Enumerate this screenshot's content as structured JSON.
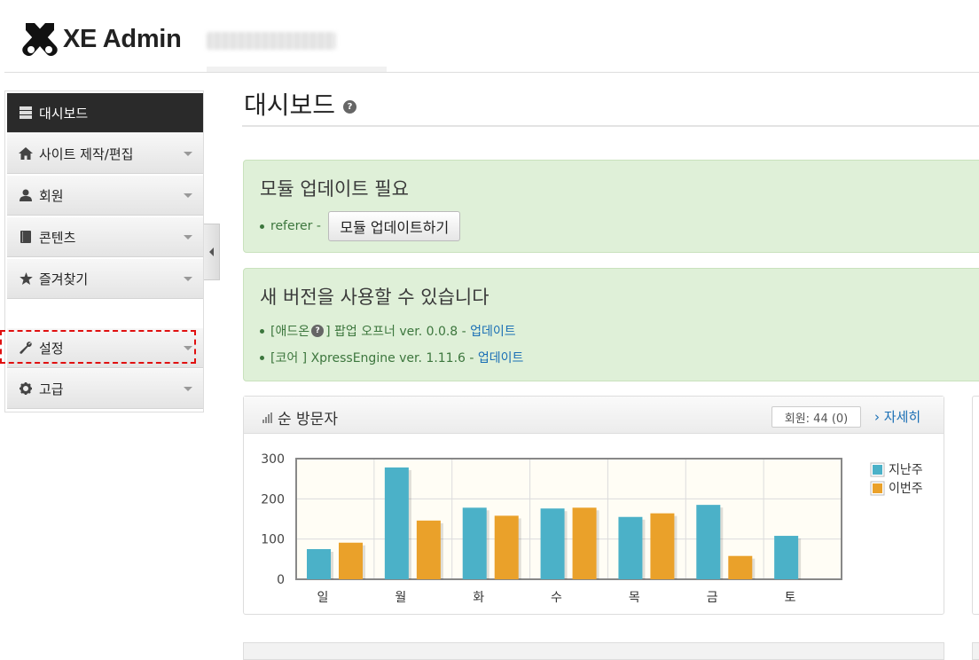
{
  "header": {
    "app_title": "XE Admin"
  },
  "sidebar": {
    "items": [
      {
        "label": "대시보드",
        "icon": "dashboard-icon",
        "active": true
      },
      {
        "label": "사이트 제작/편집",
        "icon": "home-icon"
      },
      {
        "label": "회원",
        "icon": "user-icon"
      },
      {
        "label": "콘텐츠",
        "icon": "book-icon"
      },
      {
        "label": "즐겨찾기",
        "icon": "star-icon"
      },
      {
        "label": "설정",
        "icon": "wrench-icon"
      },
      {
        "label": "고급",
        "icon": "gear-icon"
      }
    ]
  },
  "page": {
    "title": "대시보드"
  },
  "module_alert": {
    "title": "모듈 업데이트 필요",
    "module": "referer",
    "separator": " - ",
    "button_label": "모듈 업데이트하기"
  },
  "version_alert": {
    "title": "새 버전을 사용할 수 있습니다",
    "items": [
      {
        "prefix": "[애드온",
        "suffix": "] 팝업 오프너 ver. 0.0.8 - ",
        "link": "업데이트"
      },
      {
        "prefix": "[코어 ] XpressEngine ver. 1.11.6 - ",
        "suffix": "",
        "link": "업데이트"
      }
    ]
  },
  "visitors": {
    "title": "순 방문자",
    "member_count": "회원: 44 (0)",
    "more_link": "› 자세히"
  },
  "chart_data": {
    "type": "bar",
    "categories": [
      "일",
      "월",
      "화",
      "수",
      "목",
      "금",
      "토"
    ],
    "series": [
      {
        "name": "지난주",
        "color": "#4bb1c8",
        "values": [
          75,
          278,
          178,
          176,
          155,
          185,
          108
        ]
      },
      {
        "name": "이번주",
        "color": "#eaa12a",
        "values": [
          91,
          146,
          158,
          178,
          164,
          58,
          0
        ]
      }
    ],
    "yticks": [
      0,
      100,
      200,
      300
    ],
    "ylim": [
      0,
      300
    ],
    "legend": "right",
    "grid": true
  }
}
